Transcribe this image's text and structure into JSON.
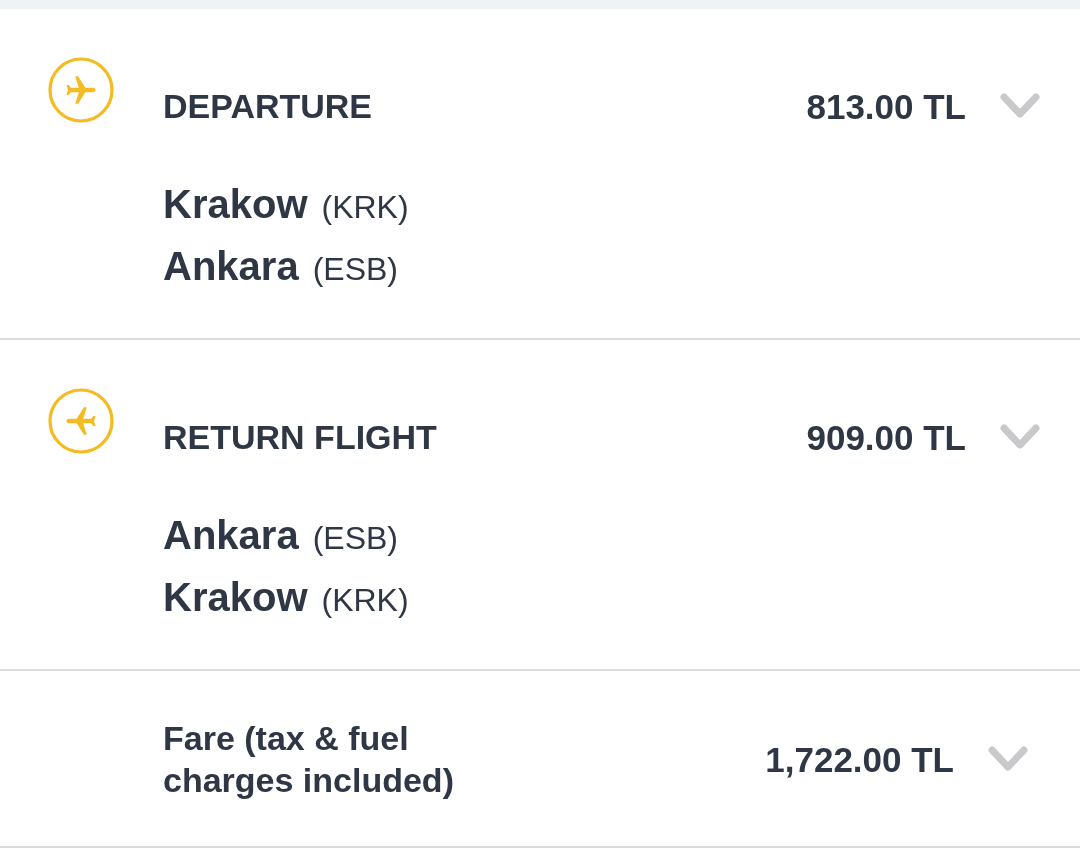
{
  "flights": [
    {
      "kind": "departure",
      "title": "DEPARTURE",
      "price": "813.00 TL",
      "expanded": false,
      "stops": [
        {
          "city": "Krakow",
          "code": "(KRK)"
        },
        {
          "city": "Ankara",
          "code": "(ESB)"
        }
      ]
    },
    {
      "kind": "return",
      "title": "RETURN FLIGHT",
      "price": "909.00 TL",
      "expanded": false,
      "stops": [
        {
          "city": "Ankara",
          "code": "(ESB)"
        },
        {
          "city": "Krakow",
          "code": "(KRK)"
        }
      ]
    }
  ],
  "fare": {
    "label": "Fare (tax & fuel charges included)",
    "price": "1,722.00 TL",
    "expanded": false
  }
}
